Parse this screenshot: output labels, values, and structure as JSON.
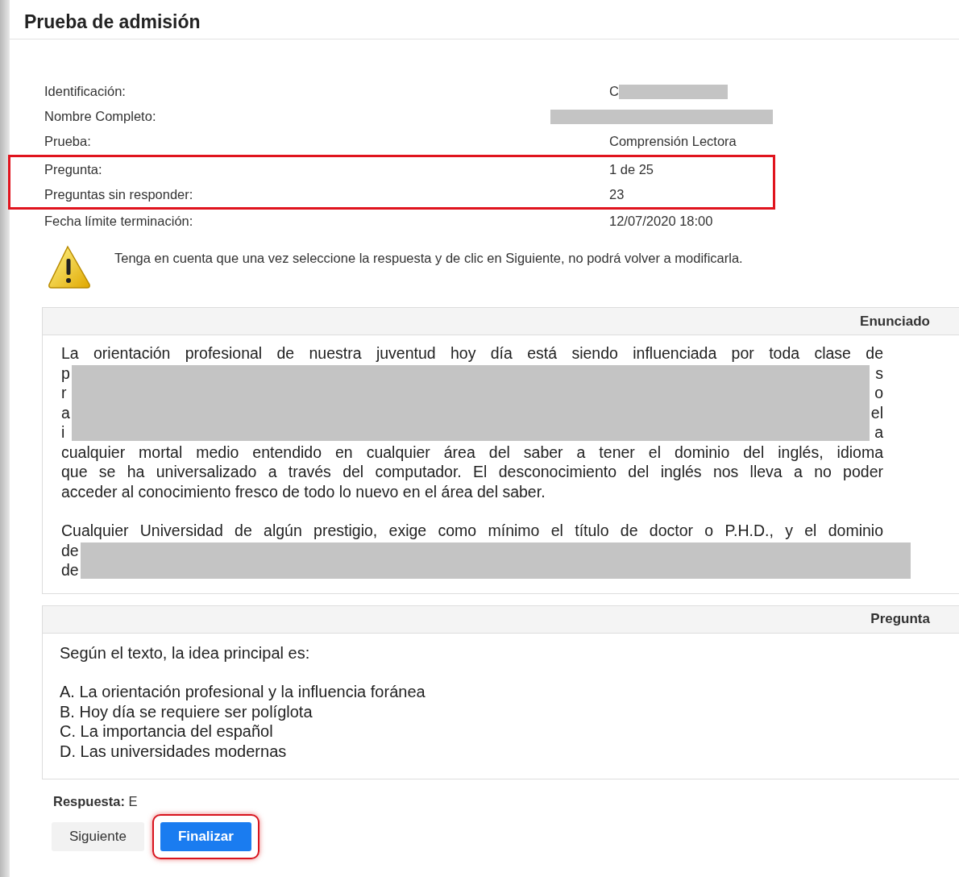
{
  "title": "Prueba de admisión",
  "info_groups": [
    {
      "highlighted": false,
      "rows": [
        {
          "label": "Identificación:",
          "value": "C",
          "redacted": true
        },
        {
          "label": "Nombre Completo:",
          "redacted": true
        },
        {
          "label": "Prueba:",
          "value": "Comprensión Lectora"
        }
      ]
    },
    {
      "highlighted": true,
      "rows": [
        {
          "label": "Pregunta:",
          "value": "1 de 25"
        },
        {
          "label": "Preguntas sin responder:",
          "value": "23"
        }
      ]
    },
    {
      "highlighted": false,
      "rows": [
        {
          "label": "Fecha límite terminación:",
          "value": "12/07/2020 18:00"
        }
      ]
    }
  ],
  "warning": "Tenga en cuenta que una vez seleccione la respuesta y de clic en Siguiente, no podrá volver a modificarla.",
  "statement": {
    "header": "Enunciado",
    "paragraphs": [
      {
        "blocks": [
          {
            "kind": "line",
            "text": "La orientación profesional de nuestra juventud hoy día está siendo influenciada por toda clase de"
          },
          {
            "kind": "redacted",
            "left": [
              "p",
              "r",
              "a",
              "i"
            ],
            "right": [
              "s",
              "o",
              "el",
              "a"
            ]
          },
          {
            "kind": "line",
            "text": "cualquier mortal medio entendido en cualquier área del saber a tener el dominio del inglés, idioma"
          },
          {
            "kind": "line",
            "text": "que se ha universalizado a través del computador. El desconocimiento del inglés nos lleva a no poder"
          },
          {
            "kind": "last",
            "text": "acceder al conocimiento fresco de todo lo nuevo en el área del saber."
          }
        ]
      },
      {
        "blocks": [
          {
            "kind": "line",
            "text": "Cualquier Universidad de algún prestigio, exige como mínimo el título de doctor o P.H.D., y el dominio"
          },
          {
            "kind": "redacted",
            "left": [
              "de",
              "de"
            ]
          }
        ]
      }
    ]
  },
  "question": {
    "header": "Pregunta",
    "prompt": "Según el texto, la idea principal es:",
    "options": [
      "A. La orientación profesional y la influencia foránea",
      "B. Hoy día se requiere ser políglota",
      "C. La importancia del español",
      "D. Las universidades modernas"
    ]
  },
  "answer": {
    "label": "Respuesta:",
    "value": "E"
  },
  "buttons": [
    {
      "label": "Siguiente",
      "kind": "secondary",
      "highlighted": false
    },
    {
      "label": "Finalizar",
      "kind": "primary",
      "highlighted": true
    }
  ]
}
